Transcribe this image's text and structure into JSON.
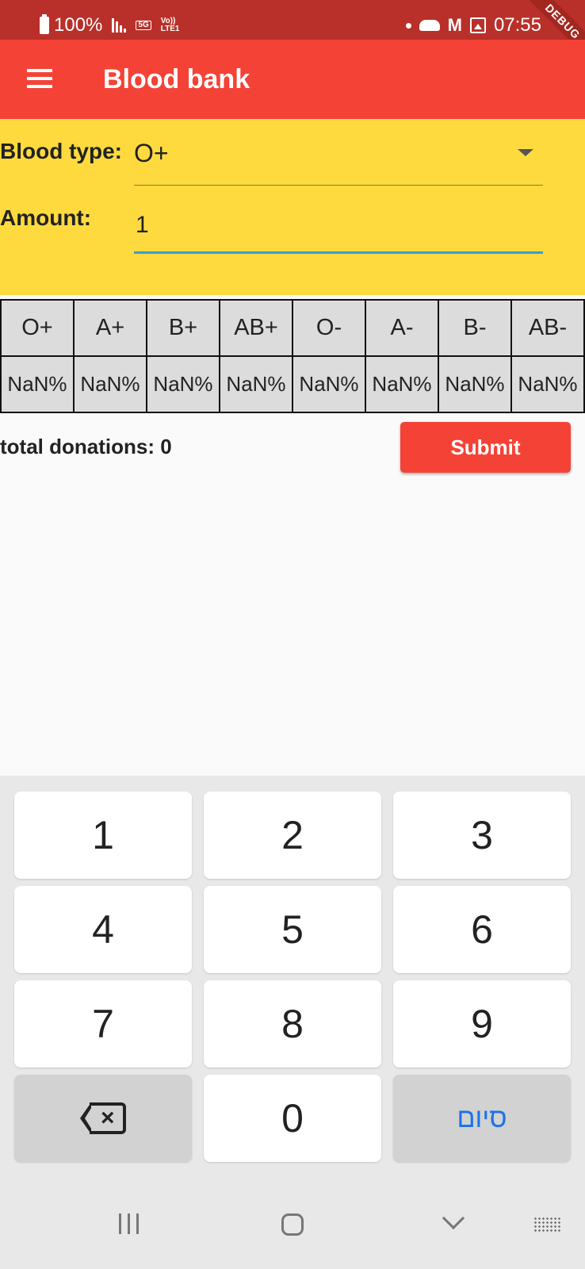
{
  "status_bar": {
    "battery": "100%",
    "network_primary": "5G",
    "network_secondary": "Vo)) LTE1",
    "time": "07:55",
    "debug_banner": "DEBUG"
  },
  "app_bar": {
    "title": "Blood bank"
  },
  "form": {
    "blood_type_label": "Blood type:",
    "blood_type_value": "O+",
    "amount_label": "Amount:",
    "amount_value": "1"
  },
  "table": {
    "headers": [
      "O+",
      "A+",
      "B+",
      "AB+",
      "O-",
      "A-",
      "B-",
      "AB-"
    ],
    "values": [
      "NaN%",
      "NaN%",
      "NaN%",
      "NaN%",
      "NaN%",
      "NaN%",
      "NaN%",
      "NaN%"
    ]
  },
  "summary": {
    "total_donations": "total donations: 0"
  },
  "submit": {
    "label": "Submit"
  },
  "keyboard": {
    "keys": [
      "1",
      "2",
      "3",
      "4",
      "5",
      "6",
      "7",
      "8",
      "9",
      "0"
    ],
    "done_label": "סיום"
  }
}
